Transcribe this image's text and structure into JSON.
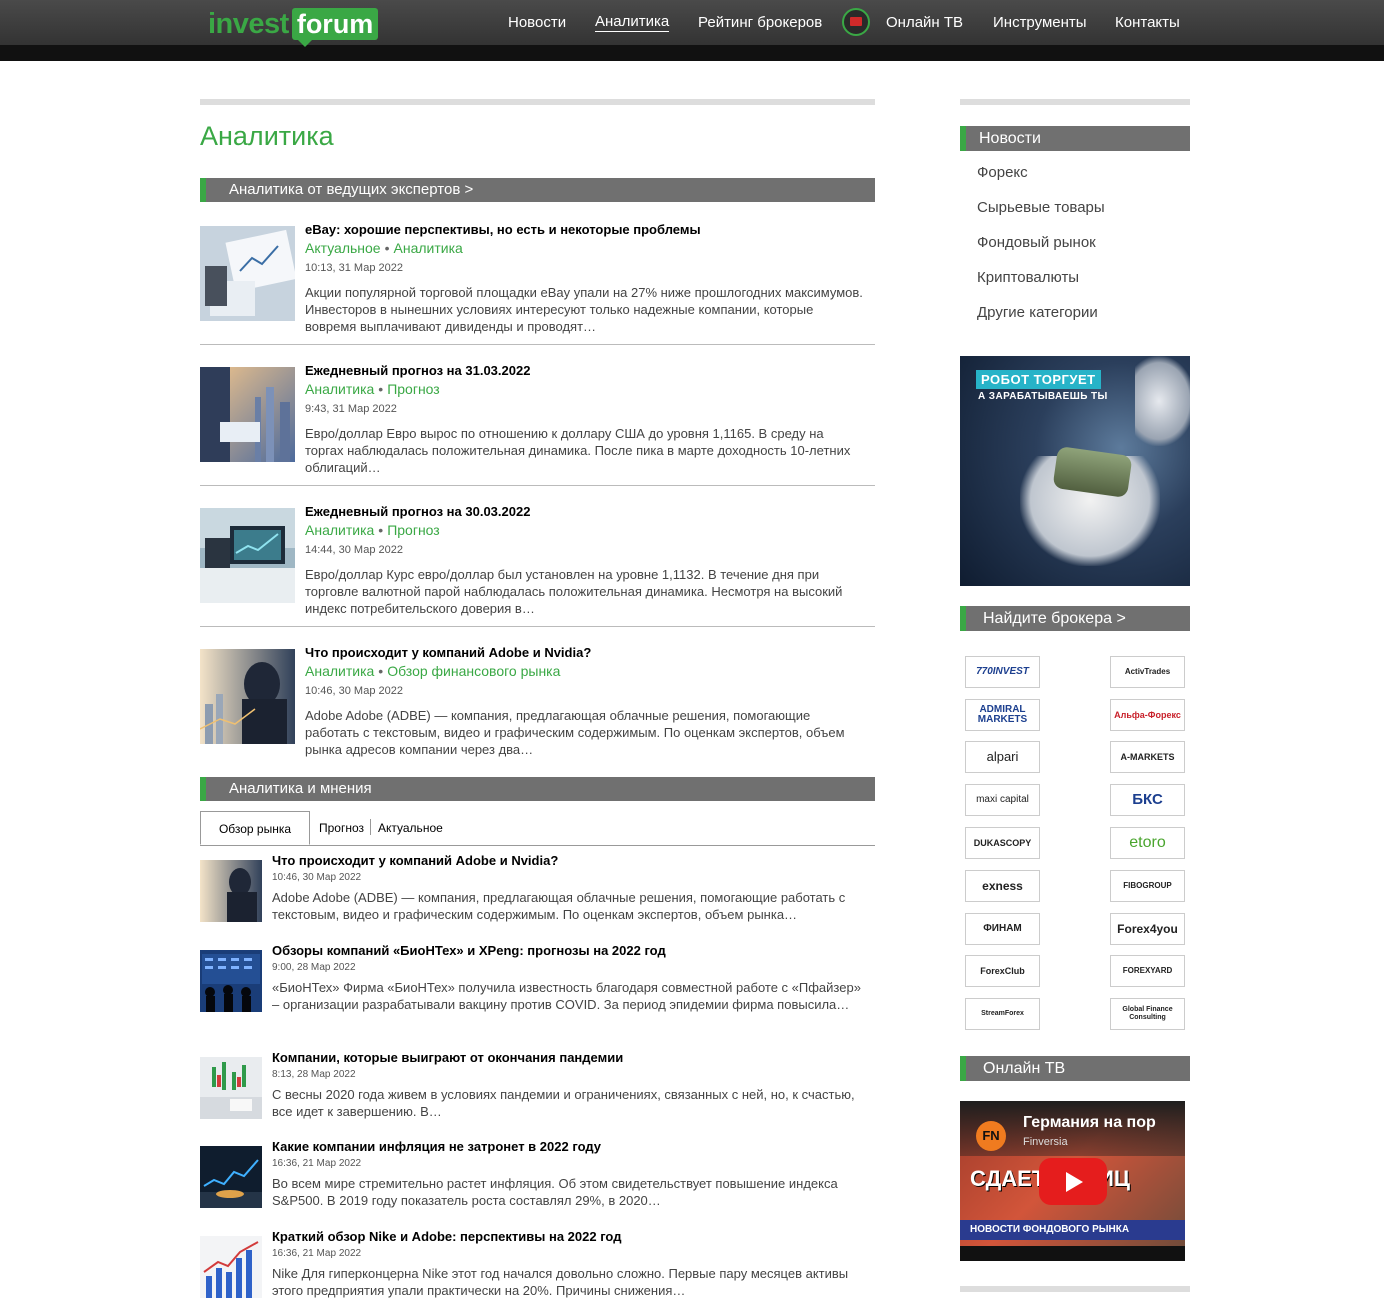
{
  "header": {
    "logo_part1": "invest",
    "logo_part2": "forum",
    "nav": [
      "Новости",
      "Аналитика",
      "Рейтинг брокеров",
      "Онлайн ТВ",
      "Инструменты",
      "Контакты"
    ]
  },
  "page_title": "Аналитика",
  "experts_section": "Аналитика от ведущих экспертов >",
  "articles": [
    {
      "title": "eBay: хорошие перспективы, но есть и некоторые проблемы",
      "tag1": "Актуальное",
      "tag2": "Аналитика",
      "date": "10:13, 31 Мар 2022",
      "text": "Акции популярной торговой площадки eBay упали на 27% ниже прошлогодних максимумов. Инвесторов в нынешних условиях интересуют только надежные компании, которые вовремя выплачивают дивиденды и проводят…"
    },
    {
      "title": "Ежедневный прогноз на 31.03.2022",
      "tag1": "Аналитика",
      "tag2": "Прогноз",
      "date": "9:43, 31 Мар 2022",
      "text": "Евро/доллар Евро вырос по отношению к доллару США до уровня 1,1165. В среду на торгах наблюдалась положительная динамика. После пика в марте доходность 10-летних облигаций…"
    },
    {
      "title": "Ежедневный прогноз на 30.03.2022",
      "tag1": "Аналитика",
      "tag2": "Прогноз",
      "date": "14:44, 30 Мар 2022",
      "text": "Евро/доллар Курс евро/доллар был установлен на уровне 1,1132. В течение дня при торговле валютной парой наблюдалась положительная динамика. Несмотря на высокий индекс потребительского доверия в…"
    },
    {
      "title": "Что происходит у компаний Adobe и Nvidia?",
      "tag1": "Аналитика",
      "tag2": "Обзор финансового рынка",
      "date": "10:46, 30 Мар 2022",
      "text": "Adobe Adobe (ADBE) — компания, предлагающая облачные решения, помогающие работать с текстовым, видео и графическим содержимым. По оценкам экспертов, объем рынка адресов компании через два…"
    }
  ],
  "opinions_section": "Аналитика и мнения",
  "tabs": [
    "Обзор рынка",
    "Прогноз",
    "Актуальное"
  ],
  "opinions": [
    {
      "title": "Что происходит у компаний Adobe и Nvidia?",
      "date": "10:46, 30 Мар 2022",
      "text": "Adobe Adobe (ADBE) — компания, предлагающая облачные решения, помогающие работать с текстовым, видео и графическим содержимым. По оценкам экспертов, объем рынка…"
    },
    {
      "title": "Обзоры компаний «БиоНТех» и XPeng: прогнозы на 2022 год",
      "date": "9:00, 28 Мар 2022",
      "text": "«БиоНТех» Фирма «БиоНТех» получила известность благодаря совместной работе с «Пфайзер» – организации разрабатывали вакцину против COVID. За период эпидемии фирма повысила…"
    },
    {
      "title": "Компании, которые выиграют от окончания пандемии",
      "date": "8:13, 28 Мар 2022",
      "text": "С весны 2020 года живем в условиях пандемии и ограничениях, связанных с ней, но, к счастью, все идет к завершению. В…"
    },
    {
      "title": "Какие компании инфляция не затронет в 2022 году",
      "date": "16:36, 21 Мар 2022",
      "text": "Во всем мире стремительно растет инфляция. Об этом свидетельствует повышение индекса S&P500. В 2019 году показатель роста составлял 29%, в 2020…"
    },
    {
      "title": "Краткий обзор Nike и Adobe: перспективы на 2022 год",
      "date": "16:36, 21 Мар 2022",
      "text": "Nike Для гиперконцерна Nike этот год начался довольно сложно. Первые пару месяцев активы этого предприятия упали практически на 20%. Причины снижения…"
    }
  ],
  "sidebar": {
    "news_title": "Новости",
    "news_links": [
      "Форекс",
      "Сырьевые товары",
      "Фондовый рынок",
      "Криптовалюты",
      "Другие категории"
    ],
    "ad_tag": "РОБОТ ТОРГУЕТ",
    "ad_sub": "А ЗАРАБАТЫВАЕШЬ ТЫ",
    "brokers_title": "Найдите брокера >",
    "brokers": [
      "770INVEST",
      "ActivTrades",
      "ADMIRAL MARKETS",
      "Альфа-Форекс",
      "alpari",
      "A-MARKETS",
      "maxi capital",
      "БКС",
      "DUKASCOPY",
      "etoro",
      "exness",
      "FIBOGROUP",
      "ФИНАМ",
      "Forex4you",
      "ForexClub",
      "FOREXYARD",
      "StreamForex",
      "Global Finance Consulting"
    ],
    "tv_title": "Онлайн ТВ",
    "video_title": "Германия на пор",
    "video_channel": "Finversia",
    "video_logo": "FN",
    "video_big": "СДАЕТ ПОЗИЦ",
    "video_news": "НОВОСТИ ФОНДОВОГО РЫНКА"
  },
  "colors": {
    "accent": "#3aa845",
    "bar": "#707070",
    "topbar": "#3c3c3c"
  }
}
